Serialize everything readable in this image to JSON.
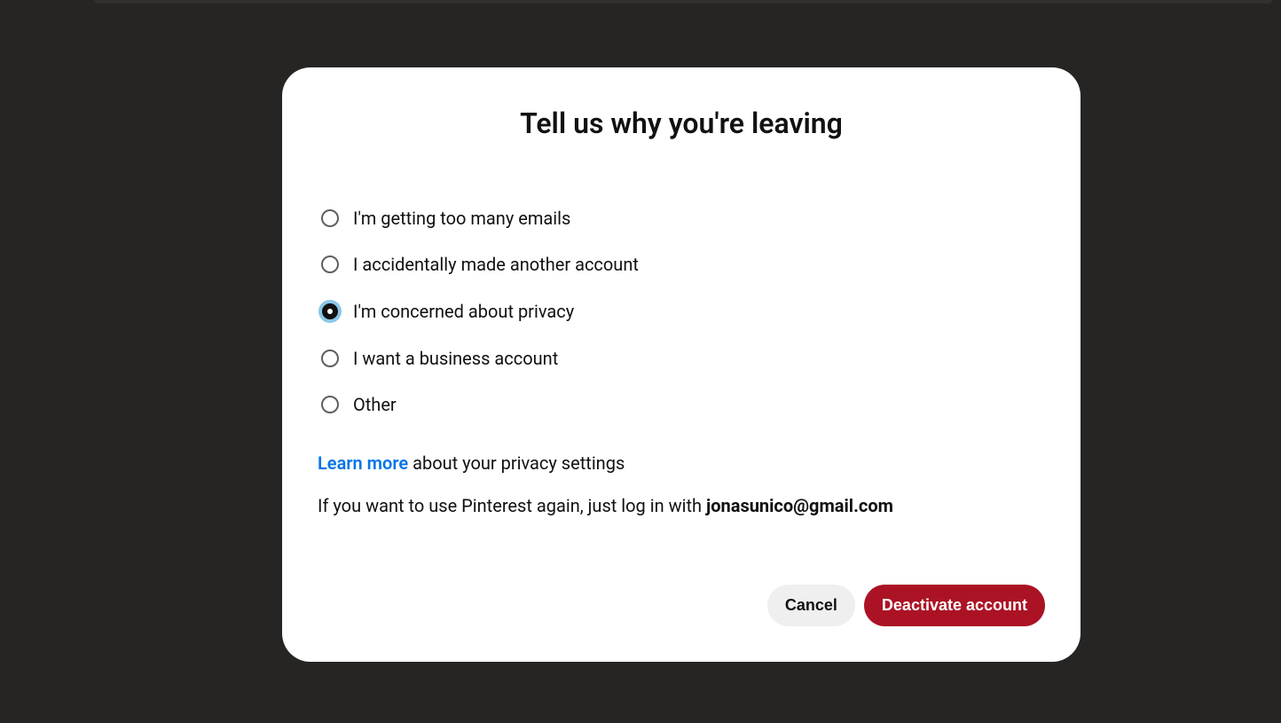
{
  "modal": {
    "title": "Tell us why you're leaving",
    "reasons": [
      {
        "label": "I'm getting too many emails",
        "selected": false
      },
      {
        "label": "I accidentally made another account",
        "selected": false
      },
      {
        "label": "I'm concerned about privacy",
        "selected": true
      },
      {
        "label": "I want a business account",
        "selected": false
      },
      {
        "label": "Other",
        "selected": false
      }
    ],
    "learn_more": {
      "link_text": "Learn more",
      "suffix_text": " about your privacy settings"
    },
    "login_info": {
      "prefix_text": "If you want to use Pinterest again, just log in with ",
      "email": "jonasunico@gmail.com"
    },
    "buttons": {
      "cancel": "Cancel",
      "deactivate": "Deactivate account"
    }
  }
}
